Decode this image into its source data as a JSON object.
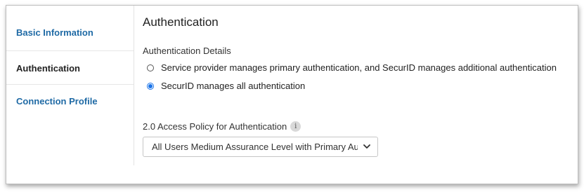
{
  "sidebar": {
    "items": [
      {
        "label": "Basic Information",
        "active": false
      },
      {
        "label": "Authentication",
        "active": true
      },
      {
        "label": "Connection Profile",
        "active": false
      }
    ]
  },
  "main": {
    "title": "Authentication",
    "section_label": "Authentication Details",
    "radio_options": [
      {
        "label": "Service provider manages primary authentication, and SecurID manages additional authentication",
        "checked": false
      },
      {
        "label": "SecurID manages all authentication",
        "checked": true
      }
    ],
    "policy": {
      "label": "2.0 Access Policy for Authentication",
      "info_icon_text": "i",
      "selected_value": "All Users Medium Assurance Level with Primary Authe"
    }
  },
  "colors": {
    "link": "#1f6aa5",
    "radio_accent": "#1a73e8"
  }
}
